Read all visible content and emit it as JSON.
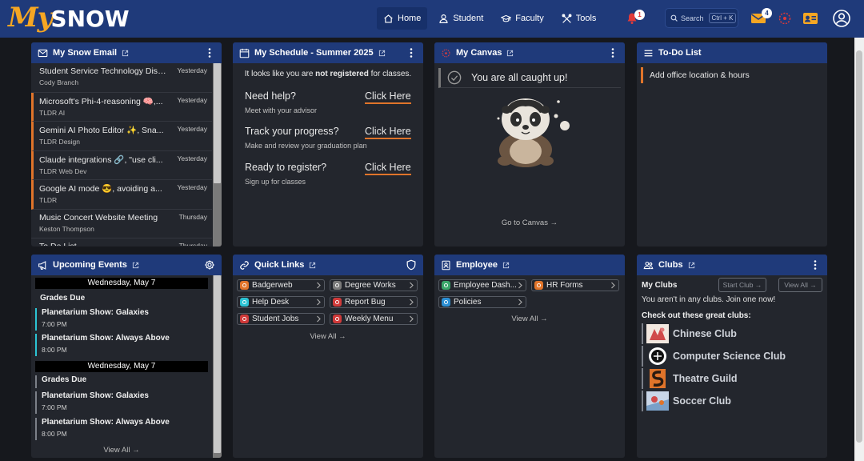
{
  "brand": {
    "my": "My",
    "snow": "SNOW"
  },
  "nav": {
    "home": "Home",
    "student": "Student",
    "faculty": "Faculty",
    "tools": "Tools"
  },
  "notifications": {
    "count": "1"
  },
  "search": {
    "label": "Search",
    "shortcut": "Ctrl + K"
  },
  "mail_badge": "4",
  "email": {
    "title": "My Snow Email",
    "items": [
      {
        "subject": "Student Service Technology Disc...",
        "from": "Cody Branch",
        "date": "Yesterday",
        "unread": false
      },
      {
        "subject": "Microsoft's Phi-4-reasoning 🧠,...",
        "from": "TLDR AI",
        "date": "Yesterday",
        "unread": true
      },
      {
        "subject": "Gemini AI Photo Editor ✨, Sna...",
        "from": "TLDR Design",
        "date": "Yesterday",
        "unread": true
      },
      {
        "subject": "Claude integrations 🔗, \"use cli...",
        "from": "TLDR Web Dev",
        "date": "Yesterday",
        "unread": true
      },
      {
        "subject": "Google AI mode 😎, avoiding a...",
        "from": "TLDR",
        "date": "Yesterday",
        "unread": true
      },
      {
        "subject": "Music Concert Website Meeting",
        "from": "Keston Thompson",
        "date": "Thursday",
        "unread": false
      },
      {
        "subject": "To Do List",
        "from": "",
        "date": "Thursday",
        "unread": false
      }
    ]
  },
  "schedule": {
    "title": "My Schedule - Summer 2025",
    "notice_pre": "It looks like you are ",
    "notice_bold": "not registered",
    "notice_post": " for classes.",
    "rows": [
      {
        "title": "Need help?",
        "sub": "Meet with your advisor",
        "link": "Click Here"
      },
      {
        "title": "Track your progress?",
        "sub": "Make and review your graduation plan",
        "link": "Click Here"
      },
      {
        "title": "Ready to register?",
        "sub": "Sign up for classes",
        "link": "Click Here"
      }
    ]
  },
  "canvas": {
    "title": "My Canvas",
    "caught_up": "You are all caught up!",
    "goto": "Go to Canvas →"
  },
  "todo": {
    "title": "To-Do List",
    "items": [
      "Add office location & hours"
    ]
  },
  "events": {
    "title": "Upcoming Events",
    "groups": [
      {
        "date": "Wednesday, May 7",
        "items": [
          {
            "name": "Grades Due",
            "time": ""
          },
          {
            "name": "Planetarium Show: Galaxies",
            "time": "7:00 PM"
          },
          {
            "name": "Planetarium Show: Always Above",
            "time": "8:00 PM"
          }
        ]
      },
      {
        "date": "Wednesday, May 7",
        "items": [
          {
            "name": "Grades Due",
            "time": ""
          },
          {
            "name": "Planetarium Show: Galaxies",
            "time": "7:00 PM"
          },
          {
            "name": "Planetarium Show: Always Above",
            "time": "8:00 PM"
          }
        ]
      }
    ],
    "view_all": "View All →"
  },
  "quicklinks": {
    "title": "Quick Links",
    "items": [
      {
        "label": "Badgerweb",
        "color": "#e0742a"
      },
      {
        "label": "Degree Works",
        "color": "#7a7a7a"
      },
      {
        "label": "Help Desk",
        "color": "#2cc3d4"
      },
      {
        "label": "Report Bug",
        "color": "#d03a3a"
      },
      {
        "label": "Student Jobs",
        "color": "#d03a3a"
      },
      {
        "label": "Weekly Menu",
        "color": "#d03a3a"
      }
    ],
    "view_all": "View All →"
  },
  "employee": {
    "title": "Employee",
    "items": [
      {
        "label": "Employee Dash...",
        "color": "#3aa66a"
      },
      {
        "label": "HR Forms",
        "color": "#e0742a"
      },
      {
        "label": "Policies",
        "color": "#2c8fd4"
      }
    ],
    "view_all": "View All →"
  },
  "clubs": {
    "title": "Clubs",
    "my_clubs": "My Clubs",
    "start_club": "Start Club →",
    "view_all": "View All →",
    "none": "You aren't in any clubs. Join one now!",
    "check_out": "Check out these great clubs:",
    "list": [
      "Chinese Club",
      "Computer Science Club",
      "Theatre Guild",
      "Soccer Club"
    ]
  }
}
